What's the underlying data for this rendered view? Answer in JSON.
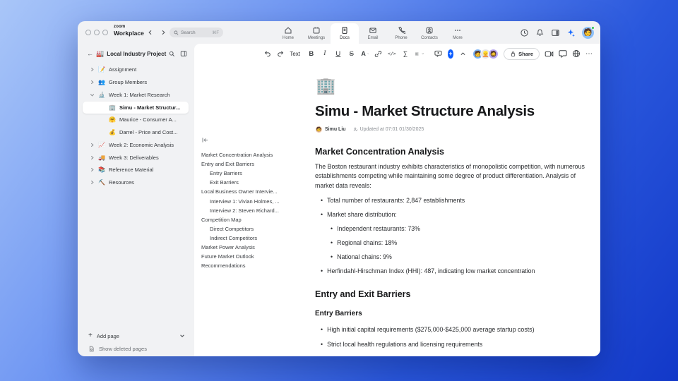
{
  "colors": {
    "accent_blue": "#0b5cff",
    "background_gradient_start": "#a9c6f8",
    "background_gradient_end": "#1238c8",
    "window_chrome": "#f1f2f4",
    "selected_item_bg": "#ffffff",
    "status_online_green": "#2cc04c"
  },
  "topbar": {
    "logo_small": "zoom",
    "logo_bold": "Workplace",
    "search_placeholder": "Search",
    "search_shortcut": "⌘F",
    "nav": [
      {
        "label": "Home"
      },
      {
        "label": "Meetings"
      },
      {
        "label": "Docs"
      },
      {
        "label": "Email"
      },
      {
        "label": "Phone"
      },
      {
        "label": "Contacts"
      },
      {
        "label": "More"
      }
    ]
  },
  "account": {
    "emoji": "🧑"
  },
  "sidebar": {
    "project_icon": "🏭",
    "project_name": "Local Industry Project",
    "items": [
      {
        "icon": "📝",
        "label": "Assignment"
      },
      {
        "icon": "👥",
        "label": "Group Members"
      },
      {
        "icon": "🔬",
        "label": "Week 1: Market Research"
      },
      {
        "icon": "🏢",
        "label": "Simu - Market Structur..."
      },
      {
        "icon": "🤗",
        "label": "Maurice - Consumer A..."
      },
      {
        "icon": "💰",
        "label": "Darrel - Price and Cost..."
      },
      {
        "icon": "📈",
        "label": "Week 2: Economic Analysis"
      },
      {
        "icon": "🚚",
        "label": "Week 3: Deliverables"
      },
      {
        "icon": "📚",
        "label": "Reference Material"
      },
      {
        "icon": "⛏️",
        "label": "Resources"
      }
    ],
    "add_page": "Add page",
    "show_deleted": "Show deleted pages"
  },
  "toolbar": {
    "text_style": "Text",
    "bold": "B",
    "italic": "I",
    "underline": "U",
    "strike": "S",
    "color": "A",
    "code": "</>",
    "formula": "∑",
    "ai_plus": "+",
    "share": "Share",
    "more": "⋯"
  },
  "collaborators": [
    {
      "emoji": "🧑"
    },
    {
      "emoji": "👱"
    },
    {
      "emoji": "🧔"
    }
  ],
  "outline": {
    "items": [
      {
        "label": "Market Concentration Analysis",
        "level": 0
      },
      {
        "label": "Entry and Exit Barriers",
        "level": 0
      },
      {
        "label": "Entry Barriers",
        "level": 1
      },
      {
        "label": "Exit Barriers",
        "level": 1
      },
      {
        "label": "Local Business Owner Intervie...",
        "level": 0
      },
      {
        "label": "Interview 1: Vivian Holmes, ...",
        "level": 1
      },
      {
        "label": "Interview 2: Steven Richard...",
        "level": 1
      },
      {
        "label": "Competition Map",
        "level": 0
      },
      {
        "label": "Direct Competitors",
        "level": 1
      },
      {
        "label": "Indirect Competitors",
        "level": 1
      },
      {
        "label": "Market Power Analysis",
        "level": 0
      },
      {
        "label": "Future Market Outlook",
        "level": 0
      },
      {
        "label": "Recommendations",
        "level": 0
      }
    ]
  },
  "doc": {
    "icon": "🏢",
    "title": "Simu - Market Structure Analysis",
    "author": "Simu Liu",
    "author_avatar": "🧑",
    "updated": "Updated at 07:01 01/30/2025",
    "s1_heading": "Market Concentration Analysis",
    "s1_para": "The Boston restaurant industry exhibits characteristics of monopolistic competition, with numerous establishments competing while maintaining some degree of product differentiation. Analysis of market data reveals:",
    "s1_b1": "Total number of restaurants: 2,847 establishments",
    "s1_b2": "Market share distribution:",
    "s1_b2_sub": [
      "Independent restaurants: 73%",
      "Regional chains: 18%",
      "National chains: 9%"
    ],
    "s1_b3": "Herfindahl-Hirschman Index (HHI): 487, indicating low market concentration",
    "s2_heading": "Entry and Exit Barriers",
    "s2_sub_heading": "Entry Barriers",
    "s2_b1": "High initial capital requirements ($275,000-$425,000 average startup costs)",
    "s2_b2": "Strict local health regulations and licensing requirements"
  }
}
